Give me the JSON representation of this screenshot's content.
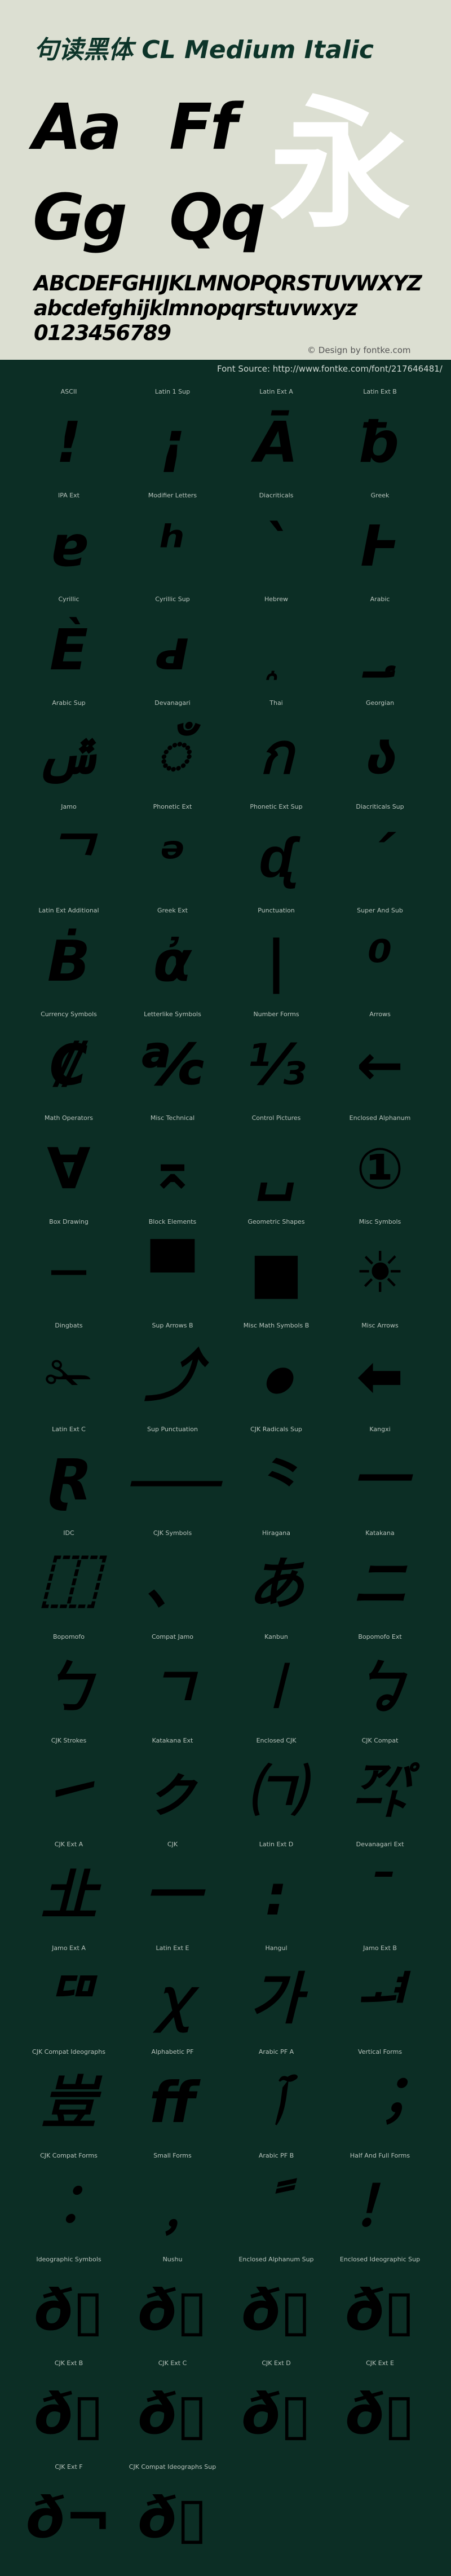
{
  "header": {
    "title": "句读黑体 CL Medium Italic",
    "sample_pairs": [
      "Aa",
      "Ff",
      "Gg",
      "Qq"
    ],
    "sample_cjk": "永",
    "uppercase": "ABCDEFGHIJKLMNOPQRSTUVWXYZ",
    "lowercase": "abcdefghijklmnopqrstuvwxyz",
    "digits": "0123456789",
    "credit": "© Design by fontke.com"
  },
  "source": "Font Source: http://www.fontke.com/font/217646481/",
  "colors": {
    "header_bg": "#dcdfd2",
    "body_bg": "#0c2e25",
    "title": "#0d3429",
    "glyph": "#000000",
    "cjk_sample": "#ffffff"
  },
  "blocks": [
    [
      {
        "label": "ASCII",
        "glyph": "!"
      },
      {
        "label": "Latin 1 Sup",
        "glyph": "¡"
      },
      {
        "label": "Latin Ext A",
        "glyph": "Ā"
      },
      {
        "label": "Latin Ext B",
        "glyph": "ƀ"
      }
    ],
    [
      {
        "label": "IPA Ext",
        "glyph": "ɐ"
      },
      {
        "label": "Modifier Letters",
        "glyph": "ʰ"
      },
      {
        "label": "Diacriticals",
        "glyph": "ˋ"
      },
      {
        "label": "Greek",
        "glyph": "Ͱ"
      }
    ],
    [
      {
        "label": "Cyrillic",
        "glyph": "Ѐ"
      },
      {
        "label": "Cyrillic Sup",
        "glyph": "ԁ"
      },
      {
        "label": "Hebrew",
        "glyph": "֑"
      },
      {
        "label": "Arabic",
        "glyph": "؀"
      }
    ],
    [
      {
        "label": "Arabic Sup",
        "glyph": "ݜ"
      },
      {
        "label": "Devanagari",
        "glyph": "ँ"
      },
      {
        "label": "Thai",
        "glyph": "ก"
      },
      {
        "label": "Georgian",
        "glyph": "ა"
      }
    ],
    [
      {
        "label": "Jamo",
        "glyph": "ᄀ"
      },
      {
        "label": "Phonetic Ext",
        "glyph": "ᵊ"
      },
      {
        "label": "Phonetic Ext Sup",
        "glyph": "ᶑ"
      },
      {
        "label": "Diacriticals Sup",
        "glyph": "ˊ"
      }
    ],
    [
      {
        "label": "Latin Ext Additional",
        "glyph": "Ḃ"
      },
      {
        "label": "Greek Ext",
        "glyph": "ἀ"
      },
      {
        "label": "Punctuation",
        "glyph": "|"
      },
      {
        "label": "Super And Sub",
        "glyph": "⁰"
      }
    ],
    [
      {
        "label": "Currency Symbols",
        "glyph": "₡"
      },
      {
        "label": "Letterlike Symbols",
        "glyph": "℀"
      },
      {
        "label": "Number Forms",
        "glyph": "⅓"
      },
      {
        "label": "Arrows",
        "glyph": "←"
      }
    ],
    [
      {
        "label": "Math Operators",
        "glyph": "∀"
      },
      {
        "label": "Misc Technical",
        "glyph": "⌅"
      },
      {
        "label": "Control Pictures",
        "glyph": "␣"
      },
      {
        "label": "Enclosed Alphanum",
        "glyph": "①"
      }
    ],
    [
      {
        "label": "Box Drawing",
        "glyph": "─"
      },
      {
        "label": "Block Elements",
        "glyph": "▀"
      },
      {
        "label": "Geometric Shapes",
        "glyph": "■"
      },
      {
        "label": "Misc Symbols",
        "glyph": "☀"
      }
    ],
    [
      {
        "label": "Dingbats",
        "glyph": "✁"
      },
      {
        "label": "Sup Arrows B",
        "glyph": "⤴"
      },
      {
        "label": "Misc Math Symbols B",
        "glyph": "⦁"
      },
      {
        "label": "Misc Arrows",
        "glyph": "⬅"
      }
    ],
    [
      {
        "label": "Latin Ext C",
        "glyph": "Ɽ"
      },
      {
        "label": "Sup Punctuation",
        "glyph": "⸺"
      },
      {
        "label": "CJK Radicals Sup",
        "glyph": "⺀"
      },
      {
        "label": "Kangxi",
        "glyph": "⼀"
      }
    ],
    [
      {
        "label": "IDC",
        "glyph": "⿰"
      },
      {
        "label": "CJK Symbols",
        "glyph": "、"
      },
      {
        "label": "Hiragana",
        "glyph": "あ"
      },
      {
        "label": "Katakana",
        "glyph": "ニ"
      }
    ],
    [
      {
        "label": "Bopomofo",
        "glyph": "ㄅ"
      },
      {
        "label": "Compat Jamo",
        "glyph": "ㄱ"
      },
      {
        "label": "Kanbun",
        "glyph": "㆐"
      },
      {
        "label": "Bopomofo Ext",
        "glyph": "ㆠ"
      }
    ],
    [
      {
        "label": "CJK Strokes",
        "glyph": "㇀"
      },
      {
        "label": "Katakana Ext",
        "glyph": "ㇰ"
      },
      {
        "label": "Enclosed CJK",
        "glyph": "㈀"
      },
      {
        "label": "CJK Compat",
        "glyph": "㌀"
      }
    ],
    [
      {
        "label": "CJK Ext A",
        "glyph": "㐀"
      },
      {
        "label": "CJK",
        "glyph": "一"
      },
      {
        "label": "Latin Ext D",
        "glyph": "꞉"
      },
      {
        "label": "Devanagari Ext",
        "glyph": "ˉ"
      }
    ],
    [
      {
        "label": "Jamo Ext A",
        "glyph": "ꥠ"
      },
      {
        "label": "Latin Ext E",
        "glyph": "ꭓ"
      },
      {
        "label": "Hangul",
        "glyph": "가"
      },
      {
        "label": "Jamo Ext B",
        "glyph": "ힰ"
      }
    ],
    [
      {
        "label": "CJK Compat Ideographs",
        "glyph": "豈"
      },
      {
        "label": "Alphabetic PF",
        "glyph": "ﬀ"
      },
      {
        "label": "Arabic PF A",
        "glyph": "ﭐ"
      },
      {
        "label": "Vertical Forms",
        "glyph": "︔"
      }
    ],
    [
      {
        "label": "CJK Compat Forms",
        "glyph": "︰"
      },
      {
        "label": "Small Forms",
        "glyph": "﹐"
      },
      {
        "label": "Arabic PF B",
        "glyph": "ﹰ"
      },
      {
        "label": "Half And Full Forms",
        "glyph": "！"
      }
    ],
    [
      {
        "label": "Ideographic Symbols",
        "glyph": "ð▯"
      },
      {
        "label": "Nushu",
        "glyph": "ð▯"
      },
      {
        "label": "Enclosed Alphanum Sup",
        "glyph": "ð▯"
      },
      {
        "label": "Enclosed Ideographic Sup",
        "glyph": "ð▯"
      }
    ],
    [
      {
        "label": "CJK Ext B",
        "glyph": "ð▯"
      },
      {
        "label": "CJK Ext C",
        "glyph": "ð▯"
      },
      {
        "label": "CJK Ext D",
        "glyph": "ð▯"
      },
      {
        "label": "CJK Ext E",
        "glyph": "ð▯"
      }
    ],
    [
      {
        "label": "CJK Ext F",
        "glyph": "ð¬"
      },
      {
        "label": "CJK Compat Ideographs Sup",
        "glyph": "ð▯"
      }
    ]
  ]
}
